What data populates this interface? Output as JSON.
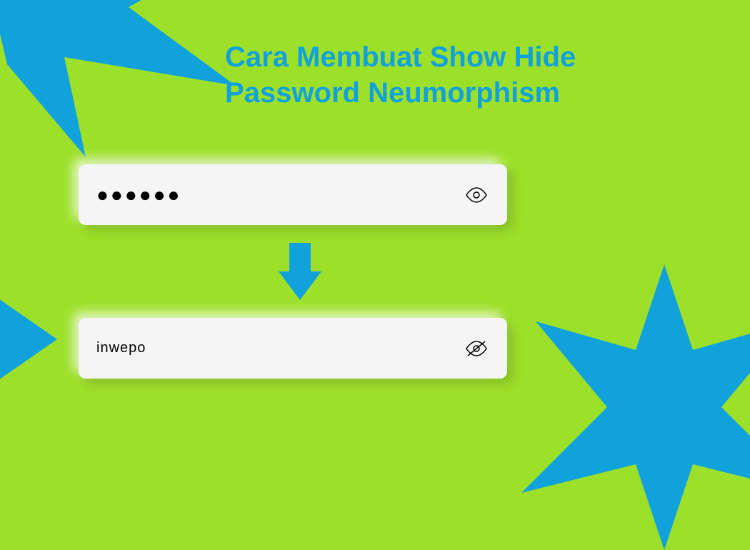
{
  "title": {
    "line1": "Cara Membuat Show Hide",
    "line2": "Password Neumorphism"
  },
  "inputs": {
    "hidden": {
      "value": "●●●●●●",
      "icon": "eye"
    },
    "visible": {
      "value": "inwepo",
      "icon": "eye-slash"
    }
  },
  "colors": {
    "background": "#9de02a",
    "accent": "#11a2dc",
    "input_bg": "#f5f5f5"
  }
}
